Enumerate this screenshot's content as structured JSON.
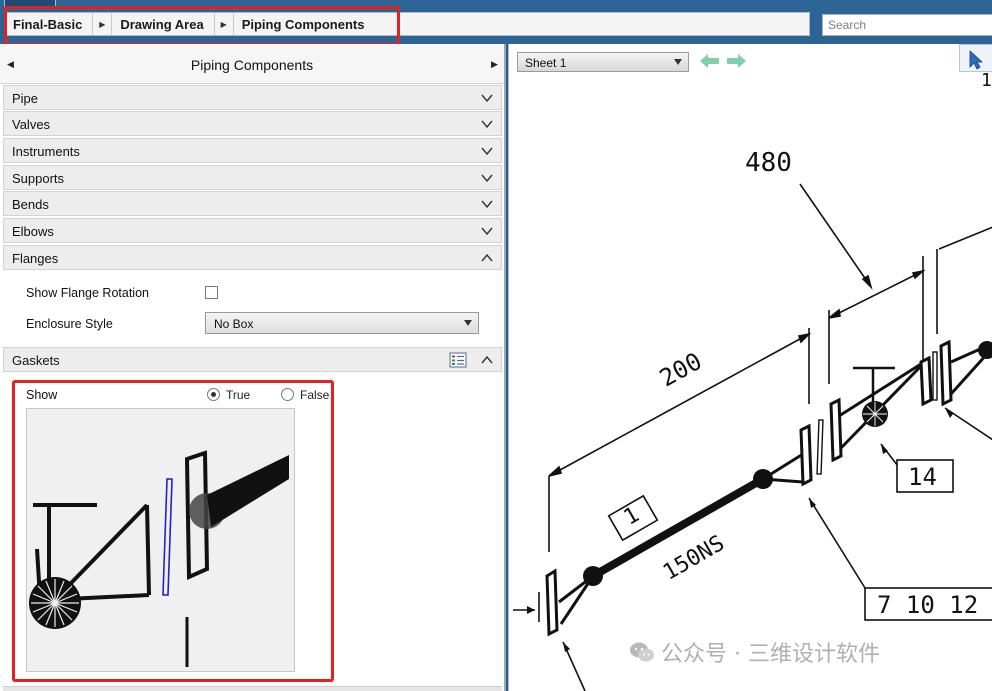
{
  "breadcrumb": [
    "Final-Basic",
    "Drawing Area",
    "Piping Components"
  ],
  "search": {
    "placeholder": "Search"
  },
  "panel": {
    "title": "Piping Components",
    "sections": [
      "Pipe",
      "Valves",
      "Instruments",
      "Supports",
      "Bends",
      "Elbows",
      "Flanges"
    ],
    "flanges": {
      "show_rotation_label": "Show Flange Rotation",
      "enclosure_label": "Enclosure Style",
      "enclosure_value": "No Box"
    },
    "gaskets": {
      "title": "Gaskets",
      "show_label": "Show",
      "true_label": "True",
      "false_label": "False",
      "selected": "True"
    }
  },
  "drawing": {
    "sheet": "Sheet 1",
    "dim_480": "480",
    "dim_200": "200",
    "tag_1": "1",
    "pipe_size": "150NS",
    "tag_14": "14",
    "tag_refs": "7 10 12",
    "corner_mark": "1"
  },
  "watermark": "公众号 · 三维设计软件",
  "colors": {
    "accent_red": "#e02222",
    "top_bar": "#2d6496",
    "nav_green": "#7fcfa9"
  }
}
